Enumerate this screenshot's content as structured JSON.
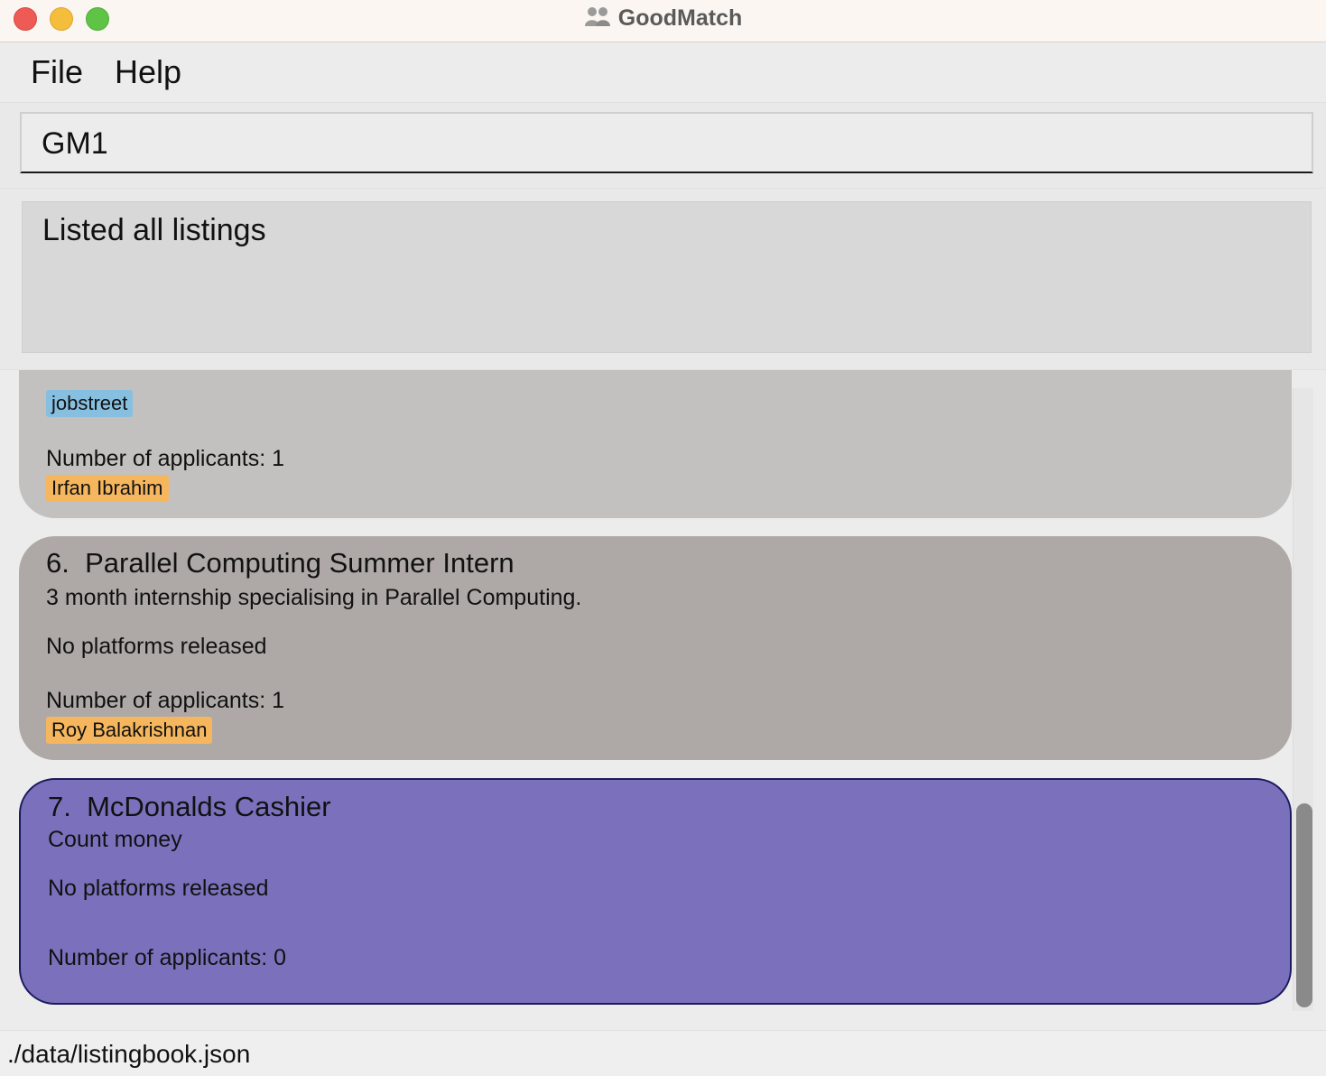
{
  "window": {
    "title": "GoodMatch",
    "icon": "people-icon"
  },
  "menu": {
    "file": "File",
    "help": "Help"
  },
  "command": {
    "value": "GM1"
  },
  "result": {
    "message": "Listed all listings"
  },
  "listings": [
    {
      "index": "",
      "title": "",
      "platform_tag": "jobstreet",
      "applicants_label": "Number of applicants: 1",
      "applicant_tag": "Irfan Ibrahim"
    },
    {
      "index": "6.",
      "title": "Parallel Computing Summer Intern",
      "description": "3 month internship specialising in Parallel Computing.",
      "platforms": "No platforms released",
      "applicants_label": "Number of applicants: 1",
      "applicant_tag": "Roy Balakrishnan"
    },
    {
      "index": "7.",
      "title": "McDonalds Cashier",
      "description": "Count money",
      "platforms": "No platforms released",
      "applicants_label": "Number of applicants: 0"
    }
  ],
  "status": {
    "path": "./data/listingbook.json"
  },
  "colors": {
    "card_default": "#c2c1bf",
    "card_alt": "#aea9a6",
    "card_selected": "#7b70bc",
    "platform_tag": "#87bfe0",
    "applicant_tag": "#f5b65e"
  }
}
